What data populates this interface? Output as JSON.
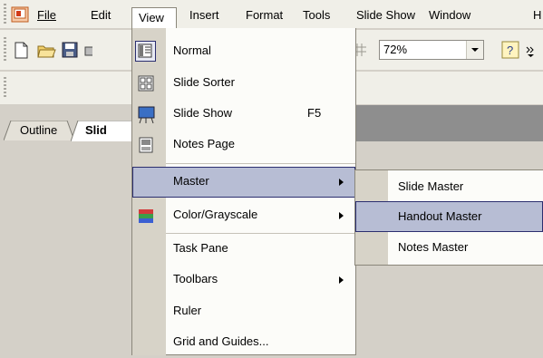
{
  "menubar": {
    "items": [
      {
        "label": "File"
      },
      {
        "label": "Edit"
      },
      {
        "label": "View"
      },
      {
        "label": "Insert"
      },
      {
        "label": "Format"
      },
      {
        "label": "Tools"
      },
      {
        "label": "Slide Show"
      },
      {
        "label": "Window"
      },
      {
        "label": "H"
      }
    ]
  },
  "toolbar": {
    "zoom_value": "72%"
  },
  "panes": {
    "tabs": [
      {
        "label": "Outline"
      },
      {
        "label": "Slid"
      }
    ]
  },
  "view_menu": {
    "items": [
      {
        "label": "Normal",
        "icon": "normal-view-icon"
      },
      {
        "label": "Slide Sorter",
        "icon": "slide-sorter-icon"
      },
      {
        "label": "Slide Show",
        "icon": "slide-show-icon",
        "shortcut": "F5"
      },
      {
        "label": "Notes Page",
        "icon": "notes-page-icon"
      },
      {
        "label": "Master",
        "submenu": true,
        "highlighted": true
      },
      {
        "label": "Color/Grayscale",
        "icon": "color-grayscale-icon",
        "submenu": true
      },
      {
        "label": "Task Pane"
      },
      {
        "label": "Toolbars",
        "submenu": true
      },
      {
        "label": "Ruler"
      },
      {
        "label": "Grid and Guides..."
      }
    ]
  },
  "master_submenu": {
    "items": [
      {
        "label": "Slide Master"
      },
      {
        "label": "Handout Master",
        "highlighted": true
      },
      {
        "label": "Notes Master"
      }
    ]
  },
  "colors": {
    "highlight": "#b7bdd4",
    "highlight_border": "#2b2e6f",
    "menubar_bg": "#f0efe8"
  }
}
